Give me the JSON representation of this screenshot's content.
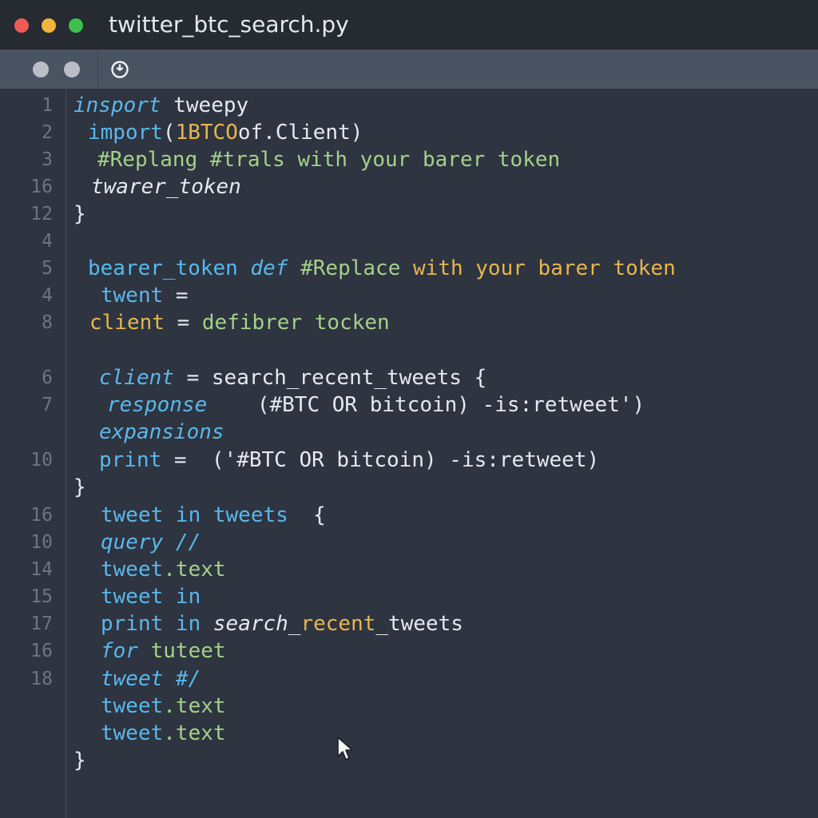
{
  "window": {
    "title": "twitter_btc_search.py"
  },
  "toolbar": {
    "icons": [
      "circle-dot-icon",
      "circle-dot-icon",
      "clock-history-icon"
    ]
  },
  "colors": {
    "keyword": "#59b8ec",
    "comment": "#a3d18a",
    "variable": "#e8b64e",
    "text": "#e5e9f0",
    "background": "#2e3440",
    "line_number": "#6d7583"
  },
  "editor": {
    "lines": [
      {
        "ln": "1",
        "parts": [
          {
            "t": "insport ",
            "c": "kwi"
          },
          {
            "t": "tweepy",
            "c": "str"
          }
        ]
      },
      {
        "ln": "2",
        "parts": [
          {
            "t": "import",
            "c": "kw"
          },
          {
            "t": "(",
            "c": "str"
          },
          {
            "t": "1BTCO",
            "c": "var"
          },
          {
            "t": "of.Client)",
            "c": "str"
          }
        ]
      },
      {
        "ln": "3",
        "parts": [
          {
            "t": "#Replang #trals with your barer token",
            "c": "cmt"
          }
        ]
      },
      {
        "ln": "16",
        "parts": [
          {
            "t": "twarer_token",
            "c": "ital"
          }
        ]
      },
      {
        "ln": "12",
        "parts": [
          {
            "t": "}",
            "c": "str"
          }
        ]
      },
      {
        "ln": "4",
        "parts": []
      },
      {
        "ln": "5",
        "parts": [
          {
            "t": "bearer_token ",
            "c": "kw"
          },
          {
            "t": "def ",
            "c": "kwi"
          },
          {
            "t": "#Replace ",
            "c": "cmt"
          },
          {
            "t": "with your barer token",
            "c": "cmt2"
          }
        ]
      },
      {
        "ln": "4",
        "parts": [
          {
            "t": "twent ",
            "c": "kw"
          },
          {
            "t": "=",
            "c": "str"
          }
        ]
      },
      {
        "ln": "8",
        "parts": [
          {
            "t": "client ",
            "c": "var"
          },
          {
            "t": "= ",
            "c": "str"
          },
          {
            "t": "defibrer tocken",
            "c": "cmt"
          }
        ]
      },
      {
        "ln": "",
        "parts": []
      },
      {
        "ln": "6",
        "parts": [
          {
            "t": "client ",
            "c": "kwi"
          },
          {
            "t": "= search_recent_tweets {",
            "c": "str"
          }
        ]
      },
      {
        "ln": "7",
        "parts": [
          {
            "t": "response",
            "c": "kwi"
          },
          {
            "t": "    (#BTC OR bitcoin) -is:retweet')",
            "c": "str"
          }
        ]
      },
      {
        "ln": "",
        "parts": [
          {
            "t": "expansions",
            "c": "kwi"
          }
        ]
      },
      {
        "ln": "10",
        "parts": [
          {
            "t": "print ",
            "c": "kw"
          },
          {
            "t": "=  ('#BTC OR bitcoin) -is:retweet)",
            "c": "str"
          }
        ]
      },
      {
        "ln": "",
        "parts": [
          {
            "t": "}",
            "c": "str"
          }
        ]
      },
      {
        "ln": "16",
        "parts": [
          {
            "t": "tweet in tweets ",
            "c": "kw"
          },
          {
            "t": " {",
            "c": "str"
          }
        ]
      },
      {
        "ln": "10",
        "parts": [
          {
            "t": "query //",
            "c": "kwi"
          }
        ]
      },
      {
        "ln": "14",
        "parts": [
          {
            "t": "tweet",
            "c": "kw"
          },
          {
            "t": ".text",
            "c": "cmt"
          }
        ]
      },
      {
        "ln": "15",
        "parts": [
          {
            "t": "tweet in",
            "c": "kw"
          }
        ]
      },
      {
        "ln": "17",
        "parts": [
          {
            "t": "print in ",
            "c": "kw"
          },
          {
            "t": "search_",
            "c": "ital"
          },
          {
            "t": "recent",
            "c": "var"
          },
          {
            "t": "_tweets",
            "c": "str"
          }
        ]
      },
      {
        "ln": "16",
        "parts": [
          {
            "t": "for ",
            "c": "kwi"
          },
          {
            "t": "tuteet",
            "c": "cmt"
          }
        ]
      },
      {
        "ln": "18",
        "parts": [
          {
            "t": "tweet #/",
            "c": "kwi"
          }
        ]
      },
      {
        "ln": "",
        "parts": [
          {
            "t": "tweet",
            "c": "kw"
          },
          {
            "t": ".text",
            "c": "cmt"
          }
        ]
      },
      {
        "ln": "",
        "parts": [
          {
            "t": "tweet",
            "c": "kw"
          },
          {
            "t": ".text",
            "c": "cmt"
          }
        ]
      },
      {
        "ln": "",
        "parts": [
          {
            "t": "}",
            "c": "str"
          }
        ]
      }
    ]
  }
}
